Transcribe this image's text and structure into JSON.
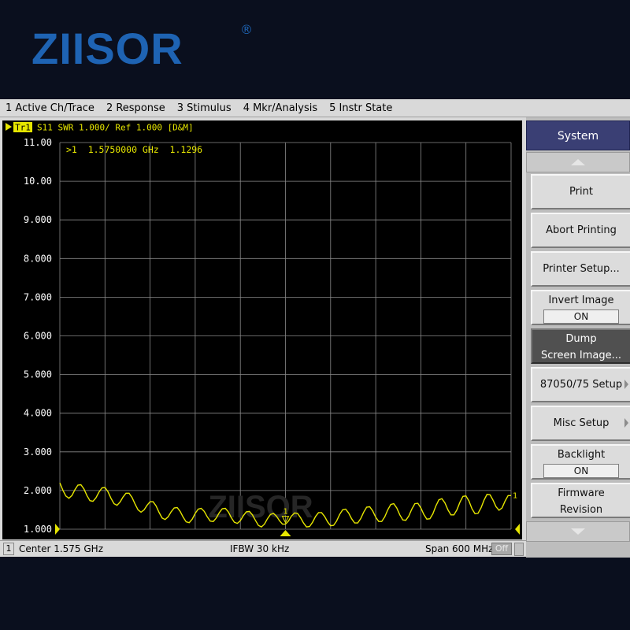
{
  "brand": {
    "logo": "ZIISOR",
    "reg_mark": "®",
    "watermark": "ZIISOR"
  },
  "menu": [
    "1 Active Ch/Trace",
    "2 Response",
    "3 Stimulus",
    "4 Mkr/Analysis",
    "5 Instr State"
  ],
  "trace_header": {
    "tag": "Tr1",
    "text": "S11  SWR 1.000/ Ref 1.000 [D&M]"
  },
  "marker": {
    "readout": ">1  1.5750000 GHz  1.1296",
    "number": "1",
    "end_label": "1"
  },
  "status": {
    "channel": "1",
    "center": "Center 1.575 GHz",
    "ifbw": "IFBW 30 kHz",
    "span": "Span 600 MHz",
    "off_label": "Off"
  },
  "softkeys": {
    "title": "System",
    "print": "Print",
    "abort": "Abort Printing",
    "printer_setup": "Printer Setup...",
    "invert_label": "Invert Image",
    "invert_state": "ON",
    "dump_line1": "Dump",
    "dump_line2": "Screen Image...",
    "setup_87050": "87050/75 Setup",
    "misc": "Misc Setup",
    "backlight_label": "Backlight",
    "backlight_state": "ON",
    "firmware_line1": "Firmware",
    "firmware_line2": "Revision"
  },
  "colors": {
    "trace": "#e6e600",
    "grid": "#8a8a8a",
    "plot_bg": "#000000",
    "softkey_header": "#3a3f74",
    "brand": "#1e63b3"
  },
  "chart_data": {
    "type": "line",
    "series": [
      {
        "x": [
          1.275,
          1.279,
          1.283,
          1.287,
          1.291,
          1.295,
          1.299,
          1.303,
          1.307,
          1.311,
          1.315,
          1.319,
          1.323,
          1.327,
          1.331,
          1.335,
          1.339,
          1.343,
          1.347,
          1.351,
          1.355,
          1.359,
          1.363,
          1.367,
          1.371,
          1.375,
          1.379,
          1.383,
          1.387,
          1.391,
          1.395,
          1.399,
          1.403,
          1.407,
          1.411,
          1.415,
          1.419,
          1.423,
          1.427,
          1.431,
          1.435,
          1.439,
          1.443,
          1.447,
          1.451,
          1.455,
          1.459,
          1.463,
          1.467,
          1.471,
          1.475,
          1.479,
          1.483,
          1.487,
          1.491,
          1.495,
          1.499,
          1.503,
          1.507,
          1.511,
          1.515,
          1.519,
          1.523,
          1.527,
          1.531,
          1.535,
          1.539,
          1.543,
          1.547,
          1.551,
          1.555,
          1.559,
          1.563,
          1.567,
          1.571,
          1.575,
          1.579,
          1.583,
          1.587,
          1.591,
          1.595,
          1.599,
          1.603,
          1.607,
          1.611,
          1.615,
          1.619,
          1.623,
          1.627,
          1.631,
          1.635,
          1.639,
          1.643,
          1.647,
          1.651,
          1.655,
          1.659,
          1.663,
          1.667,
          1.671,
          1.675,
          1.679,
          1.683,
          1.687,
          1.691,
          1.695,
          1.699,
          1.703,
          1.707,
          1.711,
          1.715,
          1.719,
          1.723,
          1.727,
          1.731,
          1.735,
          1.739,
          1.743,
          1.747,
          1.751,
          1.755,
          1.759,
          1.763,
          1.767,
          1.771,
          1.775,
          1.779,
          1.783,
          1.787,
          1.791,
          1.795,
          1.799,
          1.803,
          1.807,
          1.811,
          1.815,
          1.819,
          1.823,
          1.827,
          1.831,
          1.835,
          1.839,
          1.843,
          1.847,
          1.851,
          1.855,
          1.859,
          1.863,
          1.867,
          1.871,
          1.875
        ],
        "y": [
          2.2,
          2.01,
          1.86,
          1.8,
          1.87,
          2.02,
          2.14,
          2.15,
          2.04,
          1.87,
          1.74,
          1.72,
          1.81,
          1.96,
          2.07,
          2.08,
          1.97,
          1.8,
          1.66,
          1.62,
          1.7,
          1.83,
          1.93,
          1.93,
          1.82,
          1.65,
          1.5,
          1.44,
          1.5,
          1.62,
          1.71,
          1.71,
          1.6,
          1.43,
          1.29,
          1.25,
          1.32,
          1.45,
          1.55,
          1.56,
          1.46,
          1.31,
          1.19,
          1.17,
          1.26,
          1.41,
          1.52,
          1.54,
          1.46,
          1.32,
          1.21,
          1.2,
          1.29,
          1.43,
          1.53,
          1.54,
          1.45,
          1.3,
          1.18,
          1.15,
          1.22,
          1.35,
          1.45,
          1.46,
          1.37,
          1.23,
          1.1,
          1.06,
          1.13,
          1.27,
          1.38,
          1.41,
          1.34,
          1.22,
          1.13,
          1.13,
          1.21,
          1.34,
          1.42,
          1.41,
          1.3,
          1.16,
          1.06,
          1.07,
          1.18,
          1.33,
          1.43,
          1.43,
          1.33,
          1.19,
          1.09,
          1.1,
          1.21,
          1.38,
          1.5,
          1.52,
          1.42,
          1.27,
          1.16,
          1.16,
          1.27,
          1.44,
          1.57,
          1.58,
          1.47,
          1.31,
          1.2,
          1.2,
          1.32,
          1.5,
          1.64,
          1.66,
          1.55,
          1.37,
          1.24,
          1.23,
          1.34,
          1.52,
          1.66,
          1.67,
          1.55,
          1.38,
          1.26,
          1.27,
          1.4,
          1.6,
          1.76,
          1.79,
          1.68,
          1.5,
          1.37,
          1.37,
          1.5,
          1.7,
          1.85,
          1.86,
          1.73,
          1.53,
          1.4,
          1.41,
          1.55,
          1.75,
          1.9,
          1.89,
          1.75,
          1.58,
          1.49,
          1.55,
          1.73,
          1.87,
          1.87
        ]
      }
    ],
    "xlim": [
      1.275,
      1.875
    ],
    "ylim": [
      1.0,
      11.0
    ],
    "yticks": [
      "11.00",
      "10.00",
      "9.000",
      "8.000",
      "7.000",
      "6.000",
      "5.000",
      "4.000",
      "3.000",
      "2.000",
      "1.000"
    ],
    "grid": true,
    "marker": {
      "x": 1.575,
      "y": 1.1296
    }
  }
}
